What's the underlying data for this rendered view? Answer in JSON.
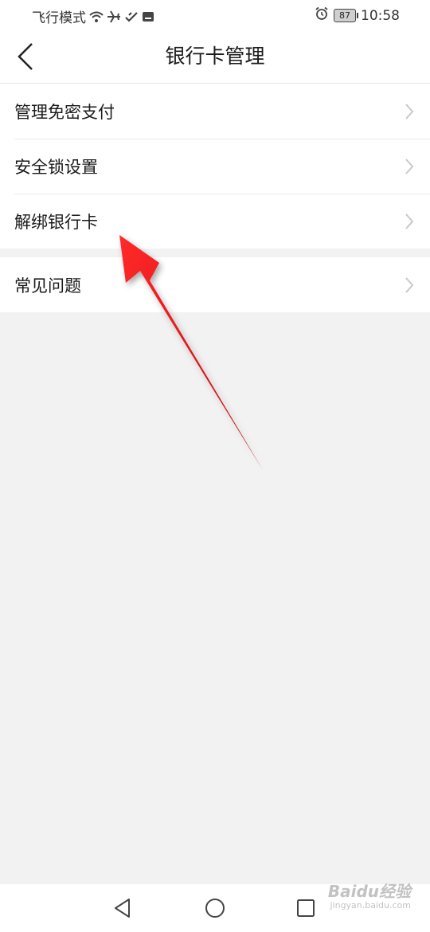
{
  "status_bar": {
    "left_text": "飞行模式",
    "icons_left": [
      "wifi-icon",
      "airplane-icon",
      "sync-icon",
      "wallet-icon"
    ],
    "icons_right": [
      "alarm-icon"
    ],
    "battery_level": "87",
    "time": "10:58"
  },
  "header": {
    "title": "银行卡管理",
    "back_icon": "chevron-left-icon"
  },
  "menu": {
    "group1": [
      {
        "label": "管理免密支付"
      },
      {
        "label": "安全锁设置"
      },
      {
        "label": "解绑银行卡"
      }
    ],
    "group2": [
      {
        "label": "常见问题"
      }
    ]
  },
  "annotation": {
    "type": "arrow",
    "color": "#e8101a",
    "points_to": "解绑银行卡"
  },
  "nav_bar": {
    "icons": [
      "triangle-back-icon",
      "circle-home-icon",
      "square-recent-icon"
    ]
  },
  "watermark": {
    "brand": "Baidu经验",
    "sub": "jingyan.baidu.com"
  },
  "colors": {
    "background": "#f2f2f2",
    "surface": "#ffffff",
    "text": "#1a1a1a",
    "divider": "#ebebeb",
    "chevron": "#c8c8c8"
  }
}
